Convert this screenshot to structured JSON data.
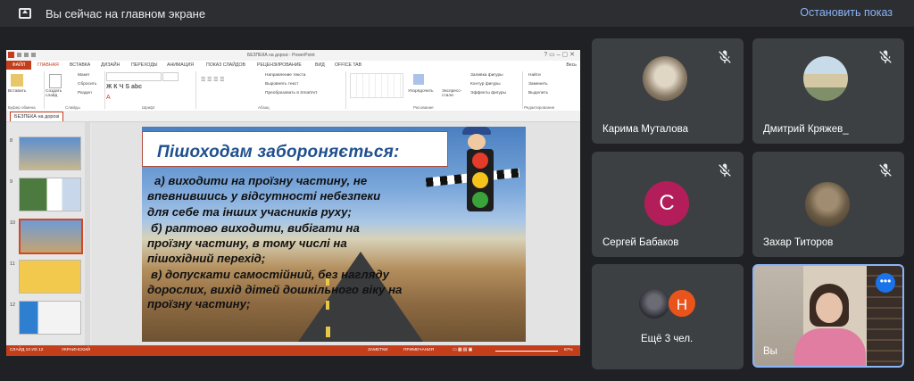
{
  "topbar": {
    "presenting_text": "Вы сейчас на главном экране",
    "stop_label": "Остановить показ"
  },
  "powerpoint": {
    "window_title": "БЕЗПЕКА на дорозі - PowerPoint",
    "tabs": [
      "ФАЙЛ",
      "ГЛАВНАЯ",
      "ВСТАВКА",
      "ДИЗАЙН",
      "ПЕРЕХОДЫ",
      "АНИМАЦИЯ",
      "ПОКАЗ СЛАЙДОВ",
      "РЕЦЕНЗИРОВАНИЕ",
      "ВИД",
      "OFFICE TAB"
    ],
    "account": "Весь",
    "ribbon": {
      "paste": "Вставить",
      "create_slide": "Создать слайд",
      "layout": "Макет",
      "reset": "Сбросить",
      "section": "Раздел",
      "text_direction": "Направление текста",
      "align_text": "Выровнять текст",
      "smartart": "Преобразовать в SmartArt",
      "arrange": "Упорядочить",
      "quick_styles": "Экспресс-стили",
      "shape_fill": "Заливка фигуры",
      "shape_outline": "Контур фигуры",
      "shape_effects": "Эффекты фигуры",
      "find": "Найти",
      "replace": "Заменить",
      "select": "Выделить",
      "groups": [
        "Буфер обмена",
        "Слайды",
        "Шрифт",
        "Абзац",
        "Рисование",
        "Редактирование"
      ]
    },
    "doc_tab": "БЕЗПЕКА на дорозі",
    "thumbnail_numbers": [
      "8",
      "9",
      "10",
      "11",
      "12"
    ],
    "slide": {
      "heading": "Пішоходам забороняється:",
      "lines": [
        "а) виходити на проїзну частину, не",
        "впевнившись у відсутності небезпеки",
        "для себе та інших учасників руху;",
        "б) раптово виходити, вибігати на",
        "проїзну частину, в тому числі на",
        "пішохідний перехід;",
        "в) допускати самостійний, без нагляду",
        "дорослих, вихід дітей дошкільного віку на",
        "проїзну частину;"
      ]
    },
    "status": {
      "slide_info": "СЛАЙД 10 ИЗ 12",
      "language": "УКРАИНСКИЙ",
      "notes": "ЗАМЕТКИ",
      "comments": "ПРИМЕЧАНИЯ",
      "zoom": "67%"
    }
  },
  "participants": [
    {
      "name": "Карима Муталова",
      "muted": true
    },
    {
      "name": "Дмитрий Кряжев_",
      "muted": true
    },
    {
      "name": "Сергей Бабаков",
      "muted": true,
      "initial": "C"
    },
    {
      "name": "Захар Титоров",
      "muted": true
    },
    {
      "name": "Ещё 3 чел.",
      "initial": "Н"
    },
    {
      "name": "Вы"
    }
  ],
  "colors": {
    "meet_bg": "#202124",
    "tile_bg": "#3c4043",
    "accent_blue": "#8ab4f8",
    "ppt_red": "#c43e1c",
    "avatar_magenta": "#b31e5a",
    "avatar_orange": "#e8541c"
  },
  "icons": [
    "present-screen-icon",
    "mic-off-icon",
    "more-options-icon"
  ]
}
